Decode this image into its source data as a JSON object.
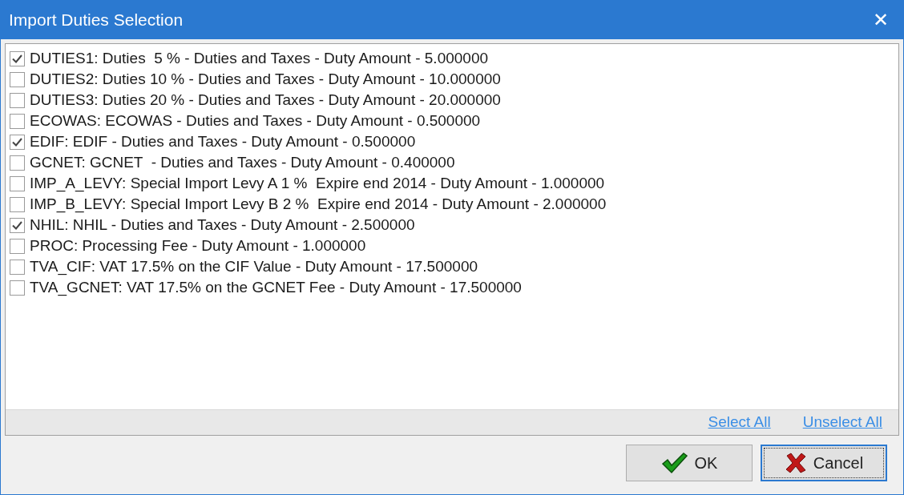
{
  "window": {
    "title": "Import Duties Selection",
    "close": "✕"
  },
  "items": [
    {
      "label": "DUTIES1: Duties  5 % - Duties and Taxes - Duty Amount - 5.000000",
      "checked": true
    },
    {
      "label": "DUTIES2: Duties 10 % - Duties and Taxes - Duty Amount - 10.000000",
      "checked": false
    },
    {
      "label": "DUTIES3: Duties 20 % - Duties and Taxes - Duty Amount - 20.000000",
      "checked": false
    },
    {
      "label": "ECOWAS: ECOWAS - Duties and Taxes - Duty Amount - 0.500000",
      "checked": false
    },
    {
      "label": "EDIF: EDIF - Duties and Taxes - Duty Amount - 0.500000",
      "checked": true
    },
    {
      "label": "GCNET: GCNET  - Duties and Taxes - Duty Amount - 0.400000",
      "checked": false
    },
    {
      "label": "IMP_A_LEVY: Special Import Levy A 1 %  Expire end 2014 - Duty Amount - 1.000000",
      "checked": false
    },
    {
      "label": "IMP_B_LEVY: Special Import Levy B 2 %  Expire end 2014 - Duty Amount - 2.000000",
      "checked": false
    },
    {
      "label": "NHIL: NHIL - Duties and Taxes - Duty Amount - 2.500000",
      "checked": true
    },
    {
      "label": "PROC: Processing Fee - Duty Amount - 1.000000",
      "checked": false
    },
    {
      "label": "TVA_CIF: VAT 17.5% on the CIF Value - Duty Amount - 17.500000",
      "checked": false
    },
    {
      "label": "TVA_GCNET: VAT 17.5% on the GCNET Fee - Duty Amount - 17.500000",
      "checked": false
    }
  ],
  "links": [
    "Select All",
    "Unselect All"
  ],
  "buttons": [
    {
      "label": "OK",
      "kind": "ok",
      "focused": false
    },
    {
      "label": "Cancel",
      "kind": "cancel",
      "focused": true
    }
  ]
}
